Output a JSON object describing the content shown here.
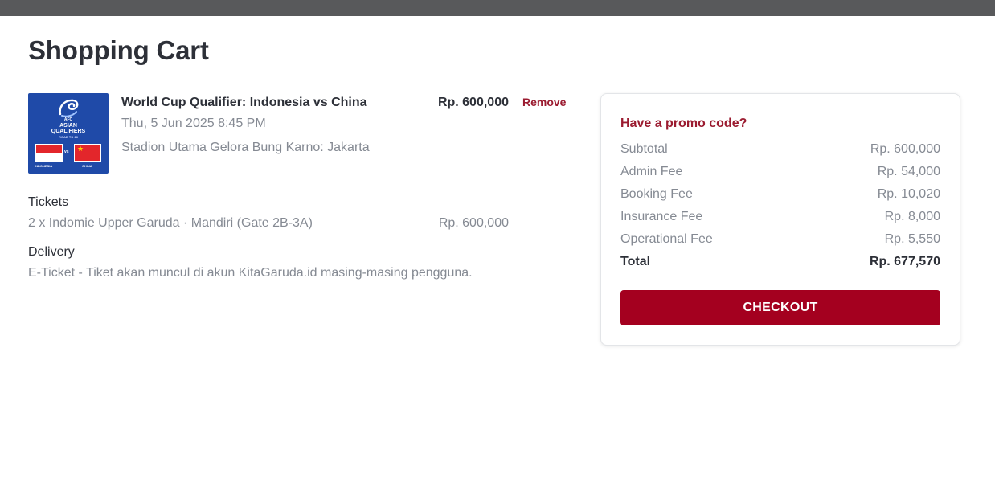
{
  "page": {
    "title": "Shopping Cart"
  },
  "event": {
    "title": "World Cup Qualifier: Indonesia vs China",
    "datetime": "Thu, 5 Jun 2025 8:45 PM",
    "venue": "Stadion Utama Gelora Bung Karno: Jakarta",
    "price": "Rp. 600,000",
    "remove_label": "Remove",
    "thumbnail": {
      "line1": "AFC",
      "line2": "ASIAN",
      "line3": "QUALIFIERS",
      "line4": "ROAD TO 26",
      "vs": "vs",
      "team_left": "INDONESIA",
      "team_right": "CHINA"
    }
  },
  "tickets": {
    "label": "Tickets",
    "line": "2 x Indomie Upper Garuda · Mandiri (Gate 2B-3A)",
    "price": "Rp. 600,000"
  },
  "delivery": {
    "label": "Delivery",
    "line": "E-Ticket - Tiket akan muncul di akun KitaGaruda.id masing-masing pengguna."
  },
  "summary": {
    "promo_label": "Have a promo code?",
    "rows": [
      {
        "label": "Subtotal",
        "value": "Rp. 600,000"
      },
      {
        "label": "Admin Fee",
        "value": "Rp. 54,000"
      },
      {
        "label": "Booking Fee",
        "value": "Rp. 10,020"
      },
      {
        "label": "Insurance Fee",
        "value": "Rp. 8,000"
      },
      {
        "label": "Operational Fee",
        "value": "Rp. 5,550"
      }
    ],
    "total": {
      "label": "Total",
      "value": "Rp. 677,570"
    },
    "checkout_label": "CHECKOUT"
  },
  "colors": {
    "accent": "#a4001f",
    "link": "#9b1b30",
    "muted_text": "#858a93",
    "topbar": "#58595b"
  }
}
